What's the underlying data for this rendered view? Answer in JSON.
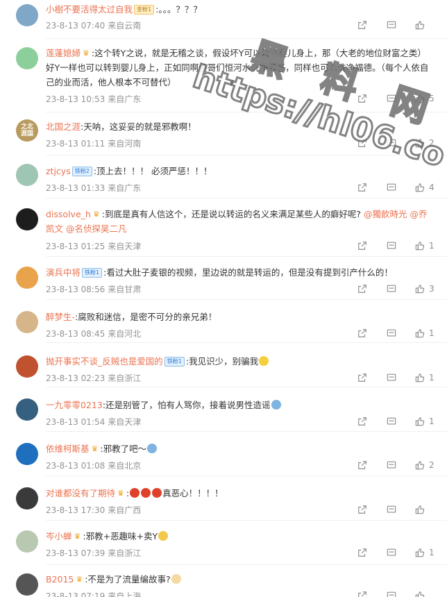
{
  "comments": [
    {
      "user": "小樹不要活得太过自我",
      "badge": "金粉1",
      "text": ":。。。？？？",
      "date": "23-8-13 07:40",
      "location": "来自云南",
      "likes": "",
      "avatar_color": "#7fa7c8"
    },
    {
      "user": "莲蓬媳婦",
      "text": ":这个转Y之说，就是无稽之谈，假设坏Y可以转到婴儿身上，那（大老的地位财富之类）好Y一样也可以转到婴儿身上，正如同啊叁哥们恒河水洗净罪恶，同样也可以洗净福德。（每个人依自己的业而活，他人根本不可替代）",
      "date": "23-8-13 10:53",
      "location": "来自广东",
      "likes": "5",
      "avatar_color": "#8ccf9a"
    },
    {
      "user": "北国之涯",
      "text": ":天呐，这妥妥的就是邪教啊！",
      "date": "23-8-13 01:11",
      "location": "来自河南",
      "likes": "2",
      "avatar_color": "#b89a5e",
      "avatar_text": "之北\n涯国"
    },
    {
      "user": "ztjcys",
      "badge": "铁粉2",
      "text": ":顶上去！！！ 必须严惩！！！",
      "date": "23-8-13 01:33",
      "location": "来自广东",
      "likes": "4",
      "avatar_color": "#9fc5b4"
    },
    {
      "user": "dissolve_h",
      "text": ":到底是真有人信这个，还是说以转运的名义来满足某些人的癖好呢?",
      "mention1": "@獨飲時光",
      "mention2": "@乔凯文",
      "mention3": "@名侦探吴二凡",
      "date": "23-8-13 01:25",
      "location": "来自天津",
      "likes": "1",
      "avatar_color": "#1d1d1d"
    },
    {
      "user": "演兵中将",
      "badge": "铁粉1",
      "text": ":看过大肚子麦银的视频，里边说的就是转运的，但是没有提到引产什么的！",
      "date": "23-8-13 08:56",
      "location": "来自甘肃",
      "likes": "3",
      "avatar_color": "#e9a34a"
    },
    {
      "user": "醉梦生-",
      "text": ":腐败和迷信，是密不可分的亲兄弟！",
      "date": "23-8-13 08:45",
      "location": "来自河北",
      "likes": "1",
      "avatar_color": "#d7b58a"
    },
    {
      "user": "抛开事实不谈_反贼也是爱国的",
      "badge": "铁粉1",
      "text": ":我见识少，别骗我",
      "date": "23-8-13 02:23",
      "location": "来自浙江",
      "likes": "1",
      "avatar_color": "#c0522f"
    },
    {
      "user": "一九零零0213",
      "text": ":还是别管了，怕有人骂你，接着说男性造谣",
      "date": "23-8-13 01:54",
      "location": "来自天津",
      "likes": "1",
      "avatar_color": "#35607f"
    },
    {
      "user": "依维柯斯基",
      "text": ":邪教了吧～",
      "date": "23-8-13 01:08",
      "location": "来自北京",
      "likes": "2",
      "avatar_color": "#1f6fbf"
    },
    {
      "user": "对谁都没有了期待",
      "text": "真恶心！！！！",
      "date": "23-8-13 17:30",
      "location": "来自广西",
      "likes": "",
      "avatar_color": "#3a3a3a"
    },
    {
      "user": "岑小蝉",
      "text": ":邪教+恶趣味+卖Y",
      "date": "23-8-13 07:39",
      "location": "来自浙江",
      "likes": "1",
      "avatar_color": "#b9c8b0"
    },
    {
      "user": "B2015",
      "text": ":不是为了流量编故事?",
      "date": "23-8-13 07:19",
      "location": "来自上海",
      "likes": "",
      "avatar_color": "#555555"
    }
  ],
  "watermark": {
    "line1": "黑 料 网",
    "line2": "https://hl06.co"
  },
  "colors": {
    "username": "#eb7350",
    "meta": "#939393",
    "icon": "#8c8c8c"
  }
}
